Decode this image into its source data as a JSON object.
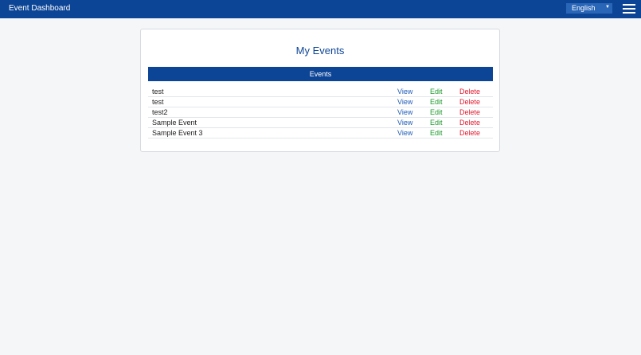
{
  "header": {
    "app_title": "Event Dashboard",
    "language": "English",
    "menu_icon": "hamburger-menu-icon"
  },
  "main": {
    "title": "My Events",
    "table_header": "Events",
    "actions": {
      "view": "View",
      "edit": "Edit",
      "delete": "Delete"
    },
    "events": [
      {
        "name": "test"
      },
      {
        "name": "test"
      },
      {
        "name": "test2"
      },
      {
        "name": "Sample Event"
      },
      {
        "name": "Sample Event 3"
      }
    ]
  },
  "colors": {
    "header_bg": "#0d4596",
    "view_link": "#1e5bb8",
    "edit_link": "#1d9a2c",
    "delete_link": "#e3172b"
  }
}
